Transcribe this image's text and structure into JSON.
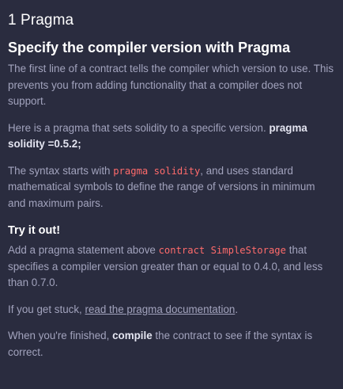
{
  "section": {
    "number_title": "1 Pragma",
    "heading": "Specify the compiler version with Pragma"
  },
  "para1": "The first line of a contract tells the compiler which version to use. This prevents you from adding functionality that a compiler does not support.",
  "para2": {
    "text": "Here is a pragma that sets solidity to a specific version. ",
    "bold": "pragma solidity =0.5.2;"
  },
  "para3": {
    "before": "The syntax starts with ",
    "code": "pragma solidity",
    "after": ", and uses standard mathematical symbols to define the range of versions in minimum and maximum pairs."
  },
  "try_it": {
    "heading": "Try it out!",
    "para": {
      "before": "Add a pragma statement above ",
      "code": "contract SimpleStorage",
      "after": " that specifies a compiler version greater than or equal to 0.4.0, and less than 0.7.0."
    }
  },
  "stuck": {
    "before": "If you get stuck, ",
    "link": "read the pragma documentation",
    "after": "."
  },
  "finished": {
    "before": "When you're finished, ",
    "bold": "compile",
    "after": " the contract to see if the syntax is correct."
  }
}
